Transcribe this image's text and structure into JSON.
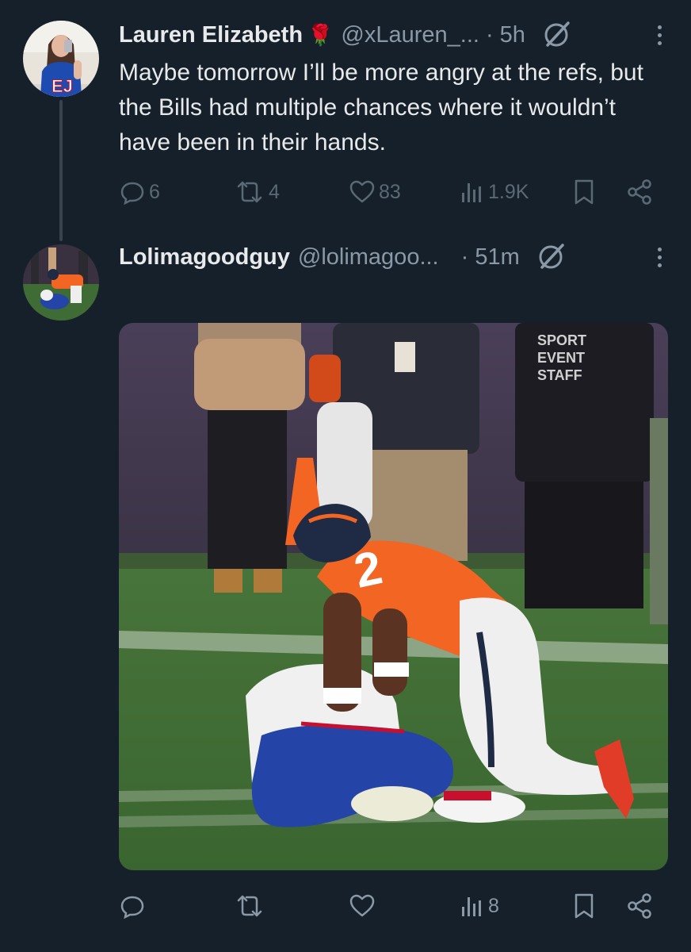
{
  "tweets": [
    {
      "author": {
        "name": "Lauren Elizabeth",
        "emoji": "🌹",
        "handle": "@xLauren_...",
        "avatar_icon": "avatar-fan-in-bills-jersey"
      },
      "time": "· 5h",
      "text": "Maybe tomorrow I’ll be more angry at the refs, but the Bills had multiple chances where it wouldn’t have been in their hands.",
      "stats": {
        "replies": "6",
        "reposts": "4",
        "likes": "83",
        "views": "1.9K"
      }
    },
    {
      "author": {
        "name": "Lolimagoodguy",
        "handle": "@lolimagoo...",
        "avatar_icon": "avatar-football-players"
      },
      "time": "· 51m",
      "media": {
        "icon": "football-photo",
        "jersey_number": "2"
      },
      "stats": {
        "replies": "",
        "reposts": "",
        "likes": "",
        "views": "8"
      }
    }
  ],
  "colors": {
    "background": "#15202b",
    "text": "#e7e9ea",
    "muted": "#8b98a5",
    "thread_line": "#38444d",
    "broncos_orange": "#f26522",
    "bills_blue": "#2544a8"
  }
}
